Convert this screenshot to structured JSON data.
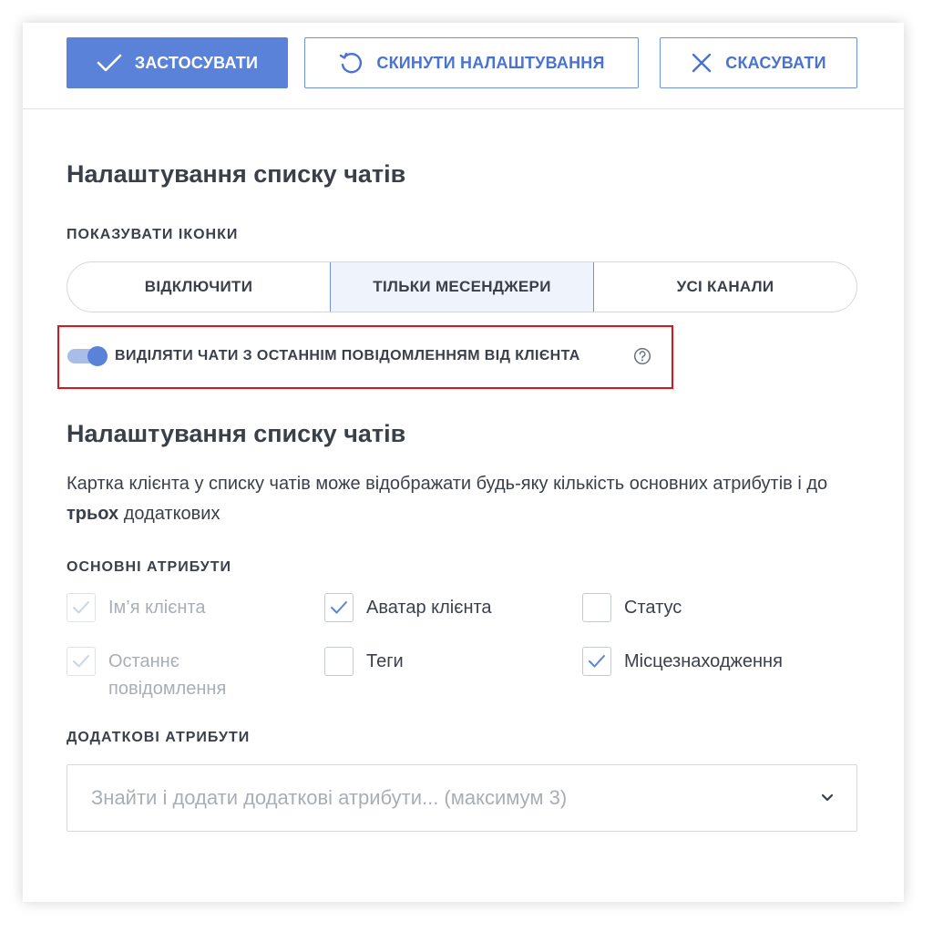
{
  "toolbar": {
    "apply_label": "ЗАСТОСУВАТИ",
    "reset_label": "СКИНУТИ НАЛАШТУВАННЯ",
    "cancel_label": "СКАСУВАТИ"
  },
  "section1": {
    "title": "Налаштування списку чатів",
    "icons_label": "ПОКАЗУВАТИ ІКОНКИ",
    "segments": [
      "ВІДКЛЮЧИТИ",
      "ТІЛЬКИ МЕСЕНДЖЕРИ",
      "УСІ КАНАЛИ"
    ],
    "selected_segment": "ТІЛЬКИ МЕСЕНДЖЕРИ",
    "toggle_label": "ВИДІЛЯТИ ЧАТИ З ОСТАННІМ ПОВІДОМЛЕННЯМ ВІД КЛІЄНТА",
    "toggle_on": true
  },
  "section2": {
    "title": "Налаштування списку чатів",
    "desc_part1": "Картка клієнта у списку чатів може відображати будь-яку кількість основних атрибутів і до ",
    "desc_bold": "трьох",
    "desc_part2": " додаткових",
    "main_attrs_label": "ОСНОВНІ АТРИБУТИ",
    "attributes": [
      {
        "label": "Ім’я клієнта",
        "checked": true,
        "disabled": true
      },
      {
        "label": "Аватар клієнта",
        "checked": true,
        "disabled": false
      },
      {
        "label": "Статус",
        "checked": false,
        "disabled": false
      },
      {
        "label": "Останнє повідомлення",
        "checked": true,
        "disabled": true
      },
      {
        "label": "Теги",
        "checked": false,
        "disabled": false
      },
      {
        "label": "Місцезнаходження",
        "checked": true,
        "disabled": false
      }
    ],
    "extra_attrs_label": "ДОДАТКОВІ АТРИБУТИ",
    "extra_placeholder": "Знайти і додати додаткові атрибути... (максимум 3)"
  },
  "colors": {
    "accent": "#5b82d9",
    "highlight_border": "#d9161c",
    "text": "#3a3f4a"
  },
  "icons": [
    "check-icon",
    "reset-icon",
    "close-icon",
    "help-icon",
    "chevron-down-icon"
  ]
}
